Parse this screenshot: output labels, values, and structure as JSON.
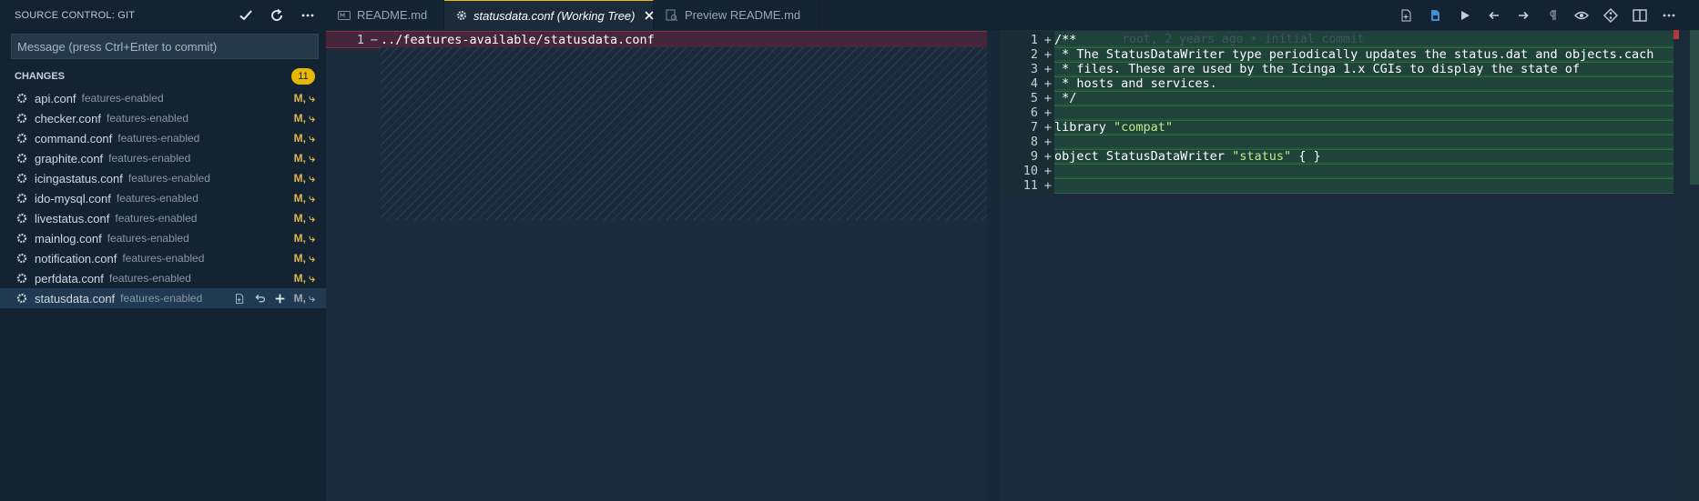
{
  "sidebar": {
    "title": "SOURCE CONTROL: GIT",
    "commit_placeholder": "Message (press Ctrl+Enter to commit)",
    "changes_label": "CHANGES",
    "changes_count": "11",
    "files": [
      {
        "name": "api.conf",
        "dir": "features-enabled",
        "status": "M, ⤷"
      },
      {
        "name": "checker.conf",
        "dir": "features-enabled",
        "status": "M, ⤷"
      },
      {
        "name": "command.conf",
        "dir": "features-enabled",
        "status": "M, ⤷"
      },
      {
        "name": "graphite.conf",
        "dir": "features-enabled",
        "status": "M, ⤷"
      },
      {
        "name": "icingastatus.conf",
        "dir": "features-enabled",
        "status": "M, ⤷"
      },
      {
        "name": "ido-mysql.conf",
        "dir": "features-enabled",
        "status": "M, ⤷"
      },
      {
        "name": "livestatus.conf",
        "dir": "features-enabled",
        "status": "M, ⤷"
      },
      {
        "name": "mainlog.conf",
        "dir": "features-enabled",
        "status": "M, ⤷"
      },
      {
        "name": "notification.conf",
        "dir": "features-enabled",
        "status": "M, ⤷"
      },
      {
        "name": "perfdata.conf",
        "dir": "features-enabled",
        "status": "M, ⤷"
      },
      {
        "name": "statusdata.conf",
        "dir": "features-enabled",
        "status": "M, ⤷"
      }
    ]
  },
  "tabs": [
    {
      "label": "README.md",
      "icon": "markdown-icon"
    },
    {
      "label": "statusdata.conf (Working Tree)",
      "icon": "gear-icon"
    },
    {
      "label": "Preview README.md",
      "icon": "preview-icon"
    }
  ],
  "left_editor": {
    "line_number": "1",
    "sign": "−",
    "text": "../features-available/statusdata.conf"
  },
  "right_editor": {
    "blame": "root, 2 years ago • initial commit",
    "lines": [
      {
        "n": "1",
        "text": "/**"
      },
      {
        "n": "2",
        "text": " * The StatusDataWriter type periodically updates the status.dat and objects.cach"
      },
      {
        "n": "3",
        "text": " * files. These are used by the Icinga 1.x CGIs to display the state of"
      },
      {
        "n": "4",
        "text": " * hosts and services."
      },
      {
        "n": "5",
        "text": " */"
      },
      {
        "n": "6",
        "text": ""
      },
      {
        "n": "7",
        "pre": "library ",
        "str": "\"compat\"",
        "post": ""
      },
      {
        "n": "8",
        "text": ""
      },
      {
        "n": "9",
        "pre": "object StatusDataWriter ",
        "str": "\"status\"",
        "post": " { }"
      },
      {
        "n": "10",
        "text": ""
      },
      {
        "n": "11",
        "text": ""
      }
    ]
  },
  "colors": {
    "accent": "#e6b800",
    "added_bg": "#2b5a3f",
    "removed_bg": "#5e2a3e"
  }
}
